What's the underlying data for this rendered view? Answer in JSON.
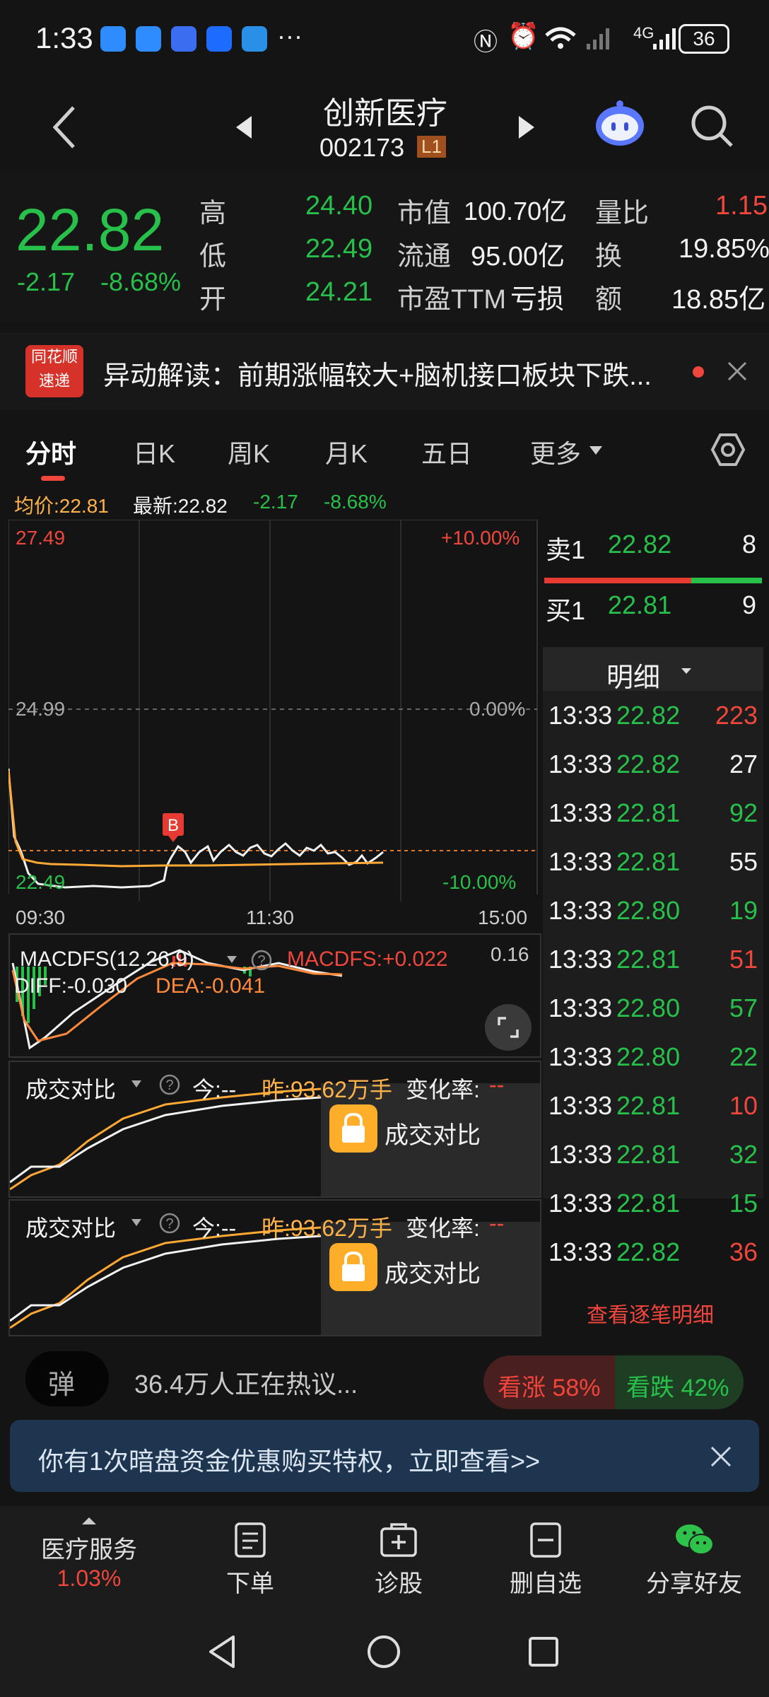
{
  "status": {
    "time": "1:33",
    "battery": "36",
    "network": "4G"
  },
  "header": {
    "name": "创新医疗",
    "code": "002173",
    "level": "L1"
  },
  "quote": {
    "price": "22.82",
    "change": "-2.17",
    "pct": "-8.68%",
    "labels": {
      "high": "高",
      "low": "低",
      "open": "开",
      "mktcap": "市值",
      "float": "流通",
      "pe": "市盈TTM",
      "volratio": "量比",
      "turnover": "换",
      "amount": "额"
    },
    "values": {
      "high": "24.40",
      "low": "22.49",
      "open": "24.21",
      "mktcap": "100.70亿",
      "float": "95.00亿",
      "pe": "亏损",
      "volratio": "1.15",
      "turnover": "19.85%",
      "amount": "18.85亿"
    }
  },
  "alert": {
    "logo1": "同花顺",
    "logo2": "速递",
    "text": "异动解读：前期涨幅较大+脑机接口板块下跌..."
  },
  "tabs": [
    "分时",
    "日K",
    "周K",
    "月K",
    "五日",
    "更多"
  ],
  "info": {
    "avg": "均价:22.81",
    "latest": "最新:22.82",
    "chg": "-2.17",
    "pct": "-8.68%"
  },
  "chart": {
    "high_label": "27.49",
    "high_pct": "+10.00%",
    "mid_label": "24.99",
    "mid_pct": "0.00%",
    "low_label": "22.49",
    "low_pct": "-10.00%",
    "marker": "B",
    "times": [
      "09:30",
      "11:30",
      "15:00"
    ]
  },
  "macd": {
    "name": "MACDFS(12,26,9)",
    "value": "MACDFS:+0.022",
    "top": "0.16",
    "diff": "DIFF:-0.030",
    "dea": "DEA:-0.041"
  },
  "compare": {
    "title": "成交对比",
    "today": "今:--",
    "yesterday": "昨:93.62万手",
    "rate_label": "变化率:",
    "rate": "--",
    "lock_text": "成交对比"
  },
  "orderbook": {
    "sell_label": "卖1",
    "sell_price": "22.82",
    "sell_qty": "8",
    "buy_label": "买1",
    "buy_price": "22.81",
    "buy_qty": "9",
    "detail_label": "明细"
  },
  "ticks": [
    {
      "time": "13:33",
      "price": "22.82",
      "vol": "223",
      "dir": "up"
    },
    {
      "time": "13:33",
      "price": "22.82",
      "vol": "27",
      "dir": "flat"
    },
    {
      "time": "13:33",
      "price": "22.81",
      "vol": "92",
      "dir": "down"
    },
    {
      "time": "13:33",
      "price": "22.81",
      "vol": "55",
      "dir": "flat"
    },
    {
      "time": "13:33",
      "price": "22.80",
      "vol": "19",
      "dir": "down"
    },
    {
      "time": "13:33",
      "price": "22.81",
      "vol": "51",
      "dir": "up"
    },
    {
      "time": "13:33",
      "price": "22.80",
      "vol": "57",
      "dir": "down"
    },
    {
      "time": "13:33",
      "price": "22.80",
      "vol": "22",
      "dir": "down"
    },
    {
      "time": "13:33",
      "price": "22.81",
      "vol": "10",
      "dir": "up"
    },
    {
      "time": "13:33",
      "price": "22.81",
      "vol": "32",
      "dir": "down"
    },
    {
      "time": "13:33",
      "price": "22.81",
      "vol": "15",
      "dir": "down"
    },
    {
      "time": "13:33",
      "price": "22.82",
      "vol": "36",
      "dir": "up"
    }
  ],
  "view_all": "查看逐笔明细",
  "discuss": {
    "badge": "弹",
    "text": "36.4万人正在热议...",
    "bull": "看涨 58%",
    "bear": "看跌 42%"
  },
  "banner": {
    "text": "你有1次暗盘资金优惠购买特权，立即查看>>"
  },
  "bottom": {
    "sector": "医疗服务",
    "sector_pct": "1.03%",
    "order": "下单",
    "diagnose": "诊股",
    "remove": "删自选",
    "share": "分享好友"
  }
}
